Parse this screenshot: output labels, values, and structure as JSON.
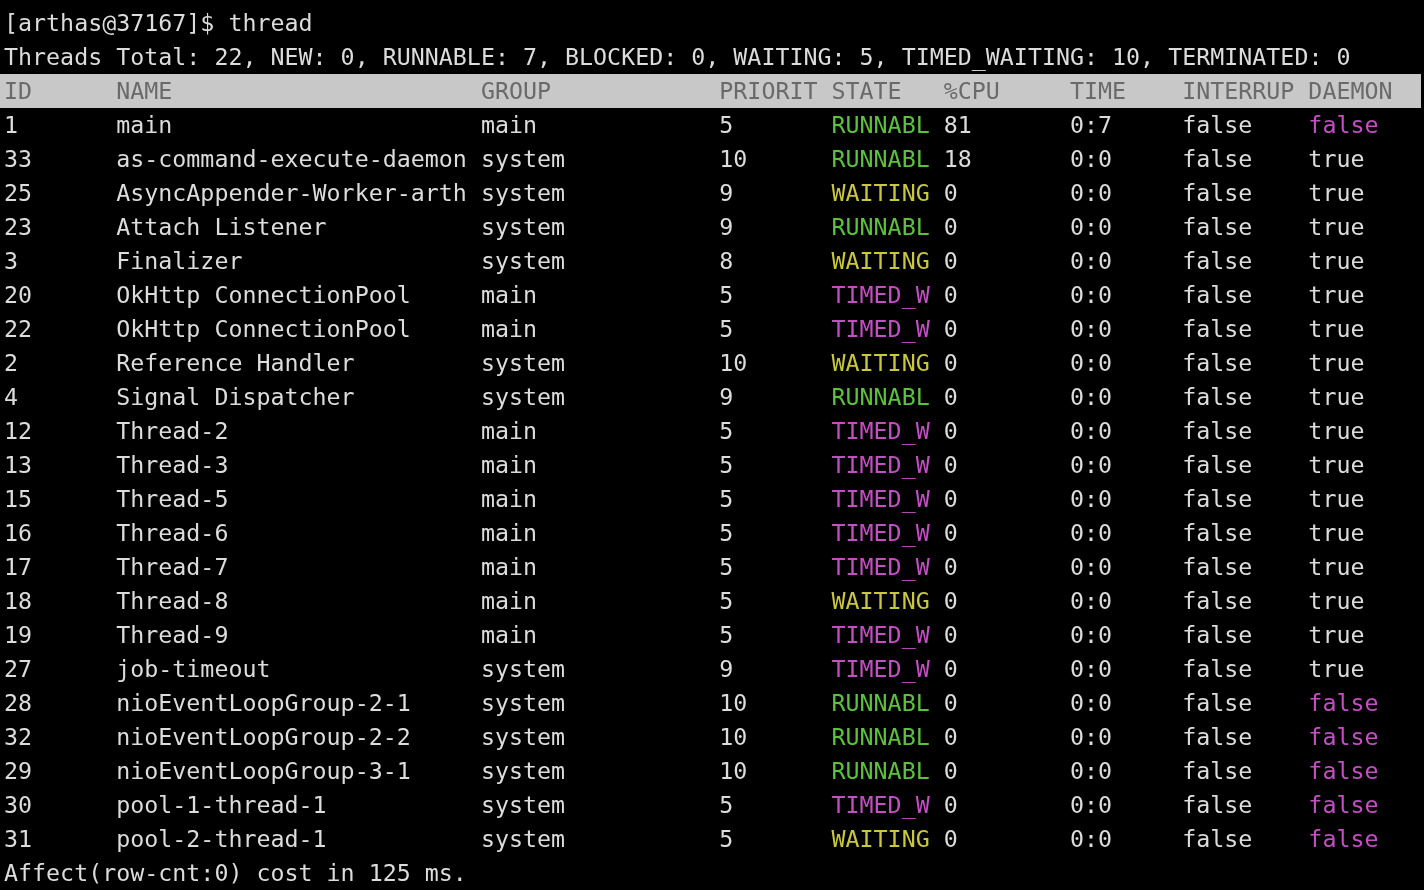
{
  "prompt": "[arthas@37167]$ thread",
  "summary": "Threads Total: 22, NEW: 0, RUNNABLE: 7, BLOCKED: 0, WAITING: 5, TIMED_WAITING: 10, TERMINATED: 0",
  "table": {
    "columns": [
      "ID",
      "NAME",
      "GROUP",
      "PRIORIT",
      "STATE",
      "%CPU",
      "TIME",
      "INTERRUP",
      "DAEMON"
    ],
    "rows": [
      {
        "id": "1",
        "name": "main",
        "group": "main",
        "priority": "5",
        "state": {
          "label": "RUNNABL",
          "color": "#5cc13c"
        },
        "cpu": "81",
        "time": "0:7",
        "interrupted": "false",
        "daemon": {
          "label": "false",
          "color": "#c34fc3"
        }
      },
      {
        "id": "33",
        "name": "as-command-execute-daemon",
        "group": "system",
        "priority": "10",
        "state": {
          "label": "RUNNABL",
          "color": "#5cc13c"
        },
        "cpu": "18",
        "time": "0:0",
        "interrupted": "false",
        "daemon": {
          "label": "true",
          "color": "#dcdcdc"
        }
      },
      {
        "id": "25",
        "name": "AsyncAppender-Worker-arth",
        "group": "system",
        "priority": "9",
        "state": {
          "label": "WAITING",
          "color": "#c9c83d"
        },
        "cpu": "0",
        "time": "0:0",
        "interrupted": "false",
        "daemon": {
          "label": "true",
          "color": "#dcdcdc"
        }
      },
      {
        "id": "23",
        "name": "Attach Listener",
        "group": "system",
        "priority": "9",
        "state": {
          "label": "RUNNABL",
          "color": "#5cc13c"
        },
        "cpu": "0",
        "time": "0:0",
        "interrupted": "false",
        "daemon": {
          "label": "true",
          "color": "#dcdcdc"
        }
      },
      {
        "id": "3",
        "name": "Finalizer",
        "group": "system",
        "priority": "8",
        "state": {
          "label": "WAITING",
          "color": "#c9c83d"
        },
        "cpu": "0",
        "time": "0:0",
        "interrupted": "false",
        "daemon": {
          "label": "true",
          "color": "#dcdcdc"
        }
      },
      {
        "id": "20",
        "name": "OkHttp ConnectionPool",
        "group": "main",
        "priority": "5",
        "state": {
          "label": "TIMED_W",
          "color": "#c34fc3"
        },
        "cpu": "0",
        "time": "0:0",
        "interrupted": "false",
        "daemon": {
          "label": "true",
          "color": "#dcdcdc"
        }
      },
      {
        "id": "22",
        "name": "OkHttp ConnectionPool",
        "group": "main",
        "priority": "5",
        "state": {
          "label": "TIMED_W",
          "color": "#c34fc3"
        },
        "cpu": "0",
        "time": "0:0",
        "interrupted": "false",
        "daemon": {
          "label": "true",
          "color": "#dcdcdc"
        }
      },
      {
        "id": "2",
        "name": "Reference Handler",
        "group": "system",
        "priority": "10",
        "state": {
          "label": "WAITING",
          "color": "#c9c83d"
        },
        "cpu": "0",
        "time": "0:0",
        "interrupted": "false",
        "daemon": {
          "label": "true",
          "color": "#dcdcdc"
        }
      },
      {
        "id": "4",
        "name": "Signal Dispatcher",
        "group": "system",
        "priority": "9",
        "state": {
          "label": "RUNNABL",
          "color": "#5cc13c"
        },
        "cpu": "0",
        "time": "0:0",
        "interrupted": "false",
        "daemon": {
          "label": "true",
          "color": "#dcdcdc"
        }
      },
      {
        "id": "12",
        "name": "Thread-2",
        "group": "main",
        "priority": "5",
        "state": {
          "label": "TIMED_W",
          "color": "#c34fc3"
        },
        "cpu": "0",
        "time": "0:0",
        "interrupted": "false",
        "daemon": {
          "label": "true",
          "color": "#dcdcdc"
        }
      },
      {
        "id": "13",
        "name": "Thread-3",
        "group": "main",
        "priority": "5",
        "state": {
          "label": "TIMED_W",
          "color": "#c34fc3"
        },
        "cpu": "0",
        "time": "0:0",
        "interrupted": "false",
        "daemon": {
          "label": "true",
          "color": "#dcdcdc"
        }
      },
      {
        "id": "15",
        "name": "Thread-5",
        "group": "main",
        "priority": "5",
        "state": {
          "label": "TIMED_W",
          "color": "#c34fc3"
        },
        "cpu": "0",
        "time": "0:0",
        "interrupted": "false",
        "daemon": {
          "label": "true",
          "color": "#dcdcdc"
        }
      },
      {
        "id": "16",
        "name": "Thread-6",
        "group": "main",
        "priority": "5",
        "state": {
          "label": "TIMED_W",
          "color": "#c34fc3"
        },
        "cpu": "0",
        "time": "0:0",
        "interrupted": "false",
        "daemon": {
          "label": "true",
          "color": "#dcdcdc"
        }
      },
      {
        "id": "17",
        "name": "Thread-7",
        "group": "main",
        "priority": "5",
        "state": {
          "label": "TIMED_W",
          "color": "#c34fc3"
        },
        "cpu": "0",
        "time": "0:0",
        "interrupted": "false",
        "daemon": {
          "label": "true",
          "color": "#dcdcdc"
        }
      },
      {
        "id": "18",
        "name": "Thread-8",
        "group": "main",
        "priority": "5",
        "state": {
          "label": "WAITING",
          "color": "#c9c83d"
        },
        "cpu": "0",
        "time": "0:0",
        "interrupted": "false",
        "daemon": {
          "label": "true",
          "color": "#dcdcdc"
        }
      },
      {
        "id": "19",
        "name": "Thread-9",
        "group": "main",
        "priority": "5",
        "state": {
          "label": "TIMED_W",
          "color": "#c34fc3"
        },
        "cpu": "0",
        "time": "0:0",
        "interrupted": "false",
        "daemon": {
          "label": "true",
          "color": "#dcdcdc"
        }
      },
      {
        "id": "27",
        "name": "job-timeout",
        "group": "system",
        "priority": "9",
        "state": {
          "label": "TIMED_W",
          "color": "#c34fc3"
        },
        "cpu": "0",
        "time": "0:0",
        "interrupted": "false",
        "daemon": {
          "label": "true",
          "color": "#dcdcdc"
        }
      },
      {
        "id": "28",
        "name": "nioEventLoopGroup-2-1",
        "group": "system",
        "priority": "10",
        "state": {
          "label": "RUNNABL",
          "color": "#5cc13c"
        },
        "cpu": "0",
        "time": "0:0",
        "interrupted": "false",
        "daemon": {
          "label": "false",
          "color": "#c34fc3"
        }
      },
      {
        "id": "32",
        "name": "nioEventLoopGroup-2-2",
        "group": "system",
        "priority": "10",
        "state": {
          "label": "RUNNABL",
          "color": "#5cc13c"
        },
        "cpu": "0",
        "time": "0:0",
        "interrupted": "false",
        "daemon": {
          "label": "false",
          "color": "#c34fc3"
        }
      },
      {
        "id": "29",
        "name": "nioEventLoopGroup-3-1",
        "group": "system",
        "priority": "10",
        "state": {
          "label": "RUNNABL",
          "color": "#5cc13c"
        },
        "cpu": "0",
        "time": "0:0",
        "interrupted": "false",
        "daemon": {
          "label": "false",
          "color": "#c34fc3"
        }
      },
      {
        "id": "30",
        "name": "pool-1-thread-1",
        "group": "system",
        "priority": "5",
        "state": {
          "label": "TIMED_W",
          "color": "#c34fc3"
        },
        "cpu": "0",
        "time": "0:0",
        "interrupted": "false",
        "daemon": {
          "label": "false",
          "color": "#c34fc3"
        }
      },
      {
        "id": "31",
        "name": "pool-2-thread-1",
        "group": "system",
        "priority": "5",
        "state": {
          "label": "WAITING",
          "color": "#c9c83d"
        },
        "cpu": "0",
        "time": "0:0",
        "interrupted": "false",
        "daemon": {
          "label": "false",
          "color": "#c34fc3"
        }
      }
    ]
  },
  "footer": "Affect(row-cnt:0) cost in 125 ms."
}
